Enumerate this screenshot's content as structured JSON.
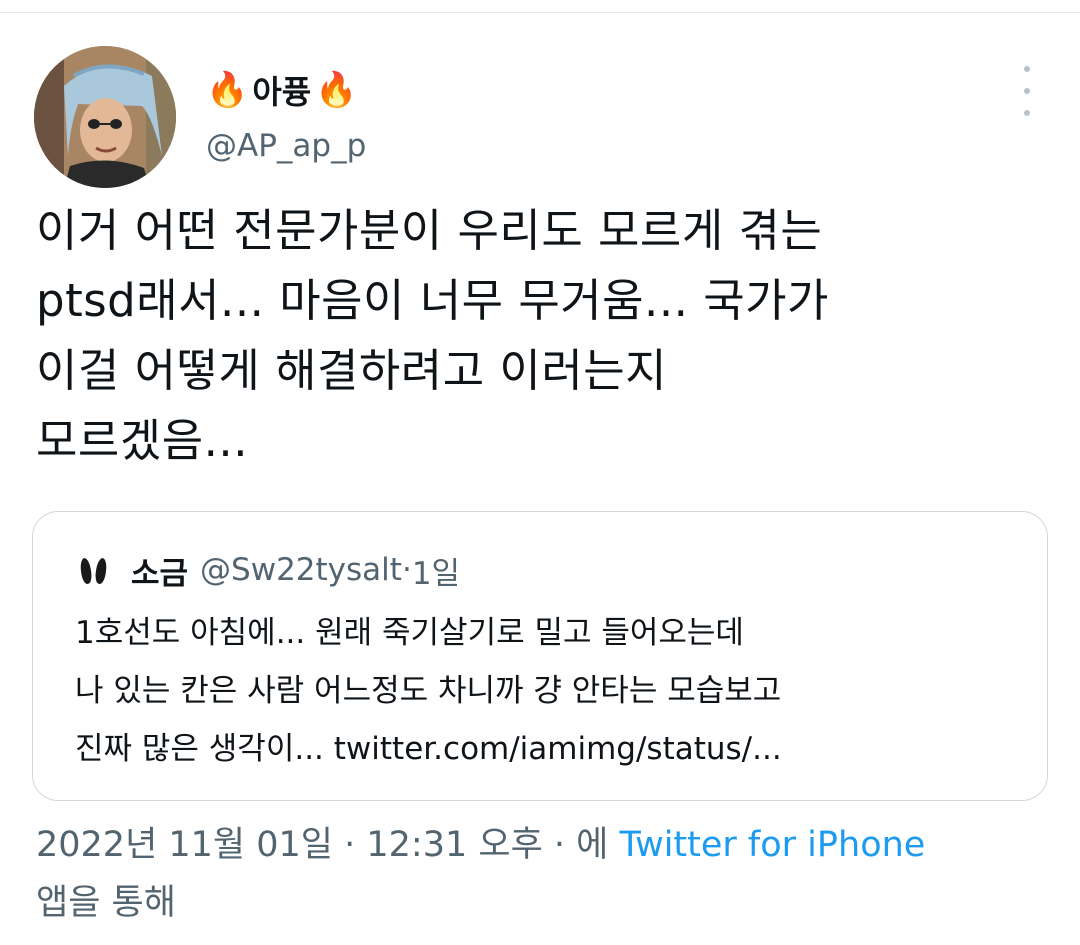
{
  "tweet": {
    "display_name": "아퓽",
    "name_emoji": "🔥",
    "handle": "@AP_ap_p",
    "text": "이거 어떤 전문가분이 우리도 모르게 겪는\nptsd래서... 마음이 너무 무거움... 국가가\n이걸 어떻게 해결하려고 이러는지\n모르겠음..."
  },
  "quoted": {
    "name": "소금",
    "handle": "@Sw22tysalt",
    "sep": " · ",
    "time": "1일",
    "text": "1호선도 아침에... 원래 죽기살기로 밀고 들어오는데\n나 있는 칸은 사람 어느정도 차니까 걍 안타는 모습보고\n진짜 많은 생각이... twitter.com/iamimg/status/..."
  },
  "meta": {
    "date": "2022년 11월 01일",
    "sep1": " · ",
    "time": "12:31 오후",
    "sep2": " · ",
    "via_prefix": "에 ",
    "source": "Twitter for iPhone",
    "via_suffix": "앱을 통해"
  },
  "icons": {
    "more": "more-vertical-icon",
    "fire": "fire-emoji"
  },
  "colors": {
    "link": "#1d9bf0",
    "secondary_text": "#536471",
    "border": "#cfd9de"
  }
}
